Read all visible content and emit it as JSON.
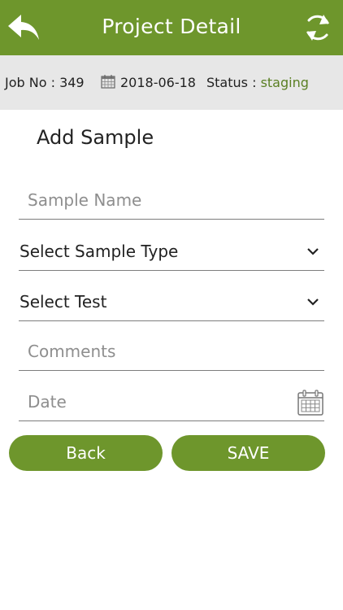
{
  "header": {
    "title": "Project Detail",
    "back_icon": "back-arrow-icon",
    "refresh_icon": "refresh-icon",
    "color": "#6e962c"
  },
  "info": {
    "job_no": "Job No : 349",
    "date": "2018-06-18",
    "status_label": "Status :",
    "status_value": "staging",
    "status_color": "#5a7f23"
  },
  "form": {
    "title": "Add Sample",
    "sample_name_placeholder": "Sample Name",
    "sample_type_label": "Select Sample Type",
    "test_label": "Select Test",
    "comments_placeholder": "Comments",
    "date_placeholder": "Date"
  },
  "buttons": {
    "back": "Back",
    "save": "SAVE"
  }
}
